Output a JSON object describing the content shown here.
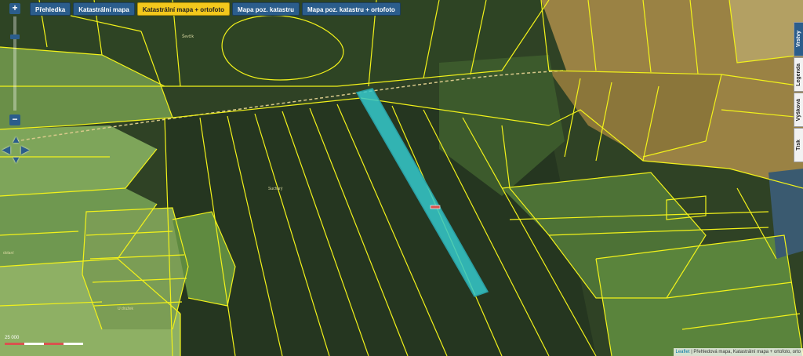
{
  "tabs": [
    {
      "label": "Přehledka",
      "active": false
    },
    {
      "label": "Katastrální mapa",
      "active": false
    },
    {
      "label": "Katastrální mapa + ortofoto",
      "active": true
    },
    {
      "label": "Mapa poz. katastru",
      "active": false
    },
    {
      "label": "Mapa poz. katastru + ortofoto",
      "active": false
    }
  ],
  "side_tabs": [
    {
      "label": "Vrstvy",
      "active": true
    },
    {
      "label": "Legenda",
      "active": false
    },
    {
      "label": "Výšková",
      "active": false
    },
    {
      "label": "Tisk",
      "active": false
    }
  ],
  "zoom": {
    "in": "+",
    "out": "−"
  },
  "pan_arrows": {
    "up": "▲",
    "down": "▼",
    "left": "◀",
    "right": "▶"
  },
  "scale": {
    "label": "25 000"
  },
  "attribution": {
    "link": "Leaflet",
    "text": "| Přehledová mapa, Katastrální mapa + ortofoto, orto"
  },
  "place_labels": [
    "Ševčík",
    "Sucharý",
    "U družek",
    "dolaní"
  ],
  "colors": {
    "parcel_line": "#f2f21a",
    "highlight_fill": "#35c9cd",
    "highlight_stroke": "#2a9fa3",
    "road_dash": "#d8c98a",
    "forest_dark": "#283a20",
    "field_light": "#7aa055",
    "farmland": "#9a8244",
    "tab_blue": "#2b5d8c",
    "tab_active": "#f3c81c"
  }
}
